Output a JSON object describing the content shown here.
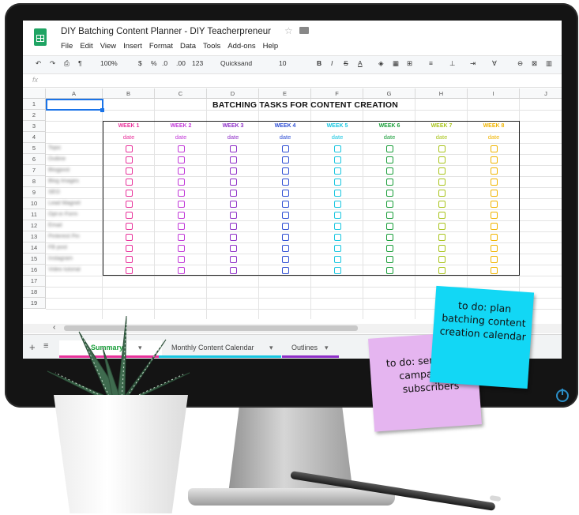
{
  "app": {
    "doc_title": "DIY Batching Content Planner - DIY Teacherpreneur",
    "menu": [
      "File",
      "Edit",
      "View",
      "Insert",
      "Format",
      "Data",
      "Tools",
      "Add-ons",
      "Help"
    ],
    "toolbar": {
      "zoom": "100%",
      "currency": "$",
      "percent": "%",
      "dec_less": ".0",
      "dec_more": ".00",
      "format": "123",
      "font": "Quicksand",
      "size": "10",
      "bold": "B",
      "italic": "I",
      "strike": "S",
      "textcolor": "A"
    },
    "fx": "fx"
  },
  "sheet": {
    "columns": [
      "A",
      "B",
      "C",
      "D",
      "E",
      "F",
      "G",
      "H",
      "I",
      "J"
    ],
    "rows": [
      "1",
      "2",
      "3",
      "4",
      "5",
      "6",
      "7",
      "8",
      "9",
      "10",
      "11",
      "12",
      "13",
      "14",
      "15",
      "16",
      "17",
      "18",
      "19"
    ],
    "title": "BATCHING TASKS FOR CONTENT CREATION",
    "weeks": [
      {
        "label": "WEEK 1",
        "date": "date",
        "color": "#e8329b"
      },
      {
        "label": "WEEK 2",
        "date": "date",
        "color": "#c23ad8"
      },
      {
        "label": "WEEK 3",
        "date": "date",
        "color": "#8e2fc7"
      },
      {
        "label": "WEEK 4",
        "date": "date",
        "color": "#2f4fd4"
      },
      {
        "label": "WEEK 5",
        "date": "date",
        "color": "#19c6e0"
      },
      {
        "label": "WEEK 6",
        "date": "date",
        "color": "#1a9e3a"
      },
      {
        "label": "WEEK 7",
        "date": "date",
        "color": "#a9c41c"
      },
      {
        "label": "WEEK 8",
        "date": "date",
        "color": "#f0b400"
      }
    ],
    "tasks": [
      "Topic",
      "Outline",
      "Blogpost",
      "Blog Images",
      "SEO",
      "Lead Magnet",
      "Opt-in Form",
      "Email",
      "Pinterest Pin",
      "FB post",
      "Instagram",
      "Video tutorial"
    ]
  },
  "tabs": [
    {
      "label": "Summary",
      "arrow": "▾",
      "color": "#e8329b"
    },
    {
      "label": "Monthly Content Calendar",
      "arrow": "▾",
      "color": "#19c6e0"
    },
    {
      "label": "Outlines",
      "arrow": "▾",
      "color": "#8e2fc7"
    }
  ],
  "notes": {
    "purple": "to do: send email campaign to subscribers",
    "blue": "to do: plan batching content creation calendar"
  },
  "colors": {
    "sheets_green": "#1fa463",
    "note_purple": "#e5b5f0",
    "note_blue": "#12d7f5",
    "selection": "#1a73e8"
  }
}
